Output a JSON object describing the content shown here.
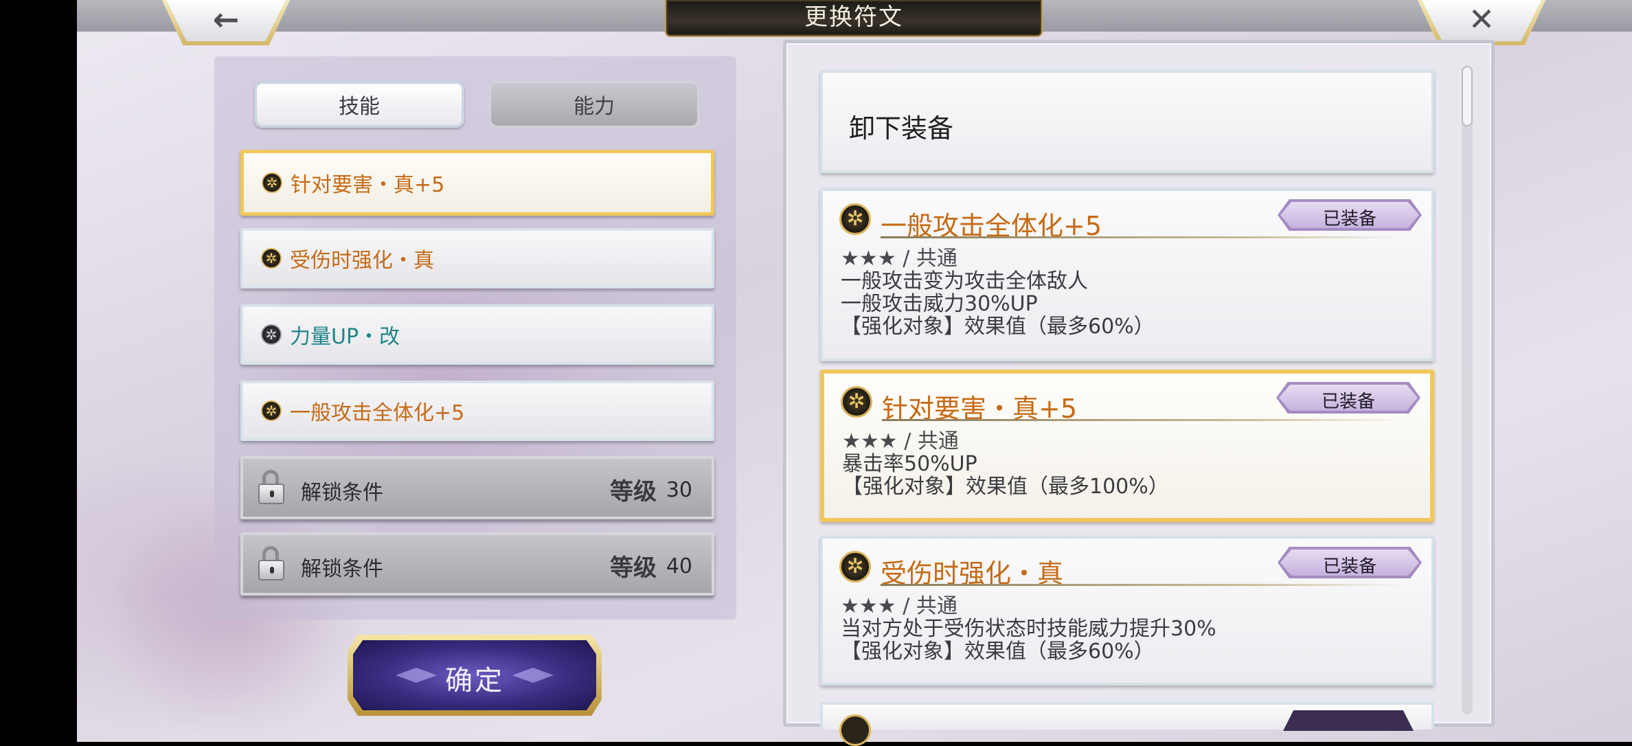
{
  "header": {
    "title": "更换符文",
    "back_icon": "←",
    "close_icon": "✕"
  },
  "left": {
    "tabs": [
      {
        "label": "技能",
        "active": true
      },
      {
        "label": "能力",
        "active": false
      }
    ],
    "rune_slots": [
      {
        "label": "针对要害・真+5",
        "color": "#c66a14",
        "selected": true
      },
      {
        "label": "受伤时强化・真",
        "color": "#c66a14",
        "selected": false
      },
      {
        "label": "力量UP・改",
        "color": "#1f8588",
        "selected": false
      },
      {
        "label": "一般攻击全体化+5",
        "color": "#c66a14",
        "selected": false
      }
    ],
    "locked_slots": [
      {
        "label": "解锁条件",
        "level_label": "等级",
        "level": "30"
      },
      {
        "label": "解锁条件",
        "level_label": "等级",
        "level": "40"
      }
    ],
    "confirm_label": "确定"
  },
  "right": {
    "unequip_label": "卸下装备",
    "cards": [
      {
        "title": "一般攻击全体化+5",
        "badge": "已装备",
        "rarity": "★★★ / 共通",
        "lines": [
          "一般攻击变为攻击全体敌人",
          "一般攻击威力30%UP",
          "【强化对象】效果值（最多60%）"
        ],
        "selected": false
      },
      {
        "title": "针对要害・真+5",
        "badge": "已装备",
        "rarity": "★★★ / 共通",
        "lines": [
          "暴击率50%UP",
          "【强化对象】效果值（最多100%）"
        ],
        "selected": true
      },
      {
        "title": "受伤时强化・真",
        "badge": "已装备",
        "rarity": "★★★ / 共通",
        "lines": [
          "当对方处于受伤状态时技能威力提升30%",
          "【强化对象】效果值（最多60%）"
        ],
        "selected": false
      }
    ]
  },
  "colors": {
    "accent_gold": "#f0c85a",
    "rune_orange": "#c66a14",
    "rune_teal": "#1f8588",
    "confirm_purple": "#3a2c80"
  }
}
